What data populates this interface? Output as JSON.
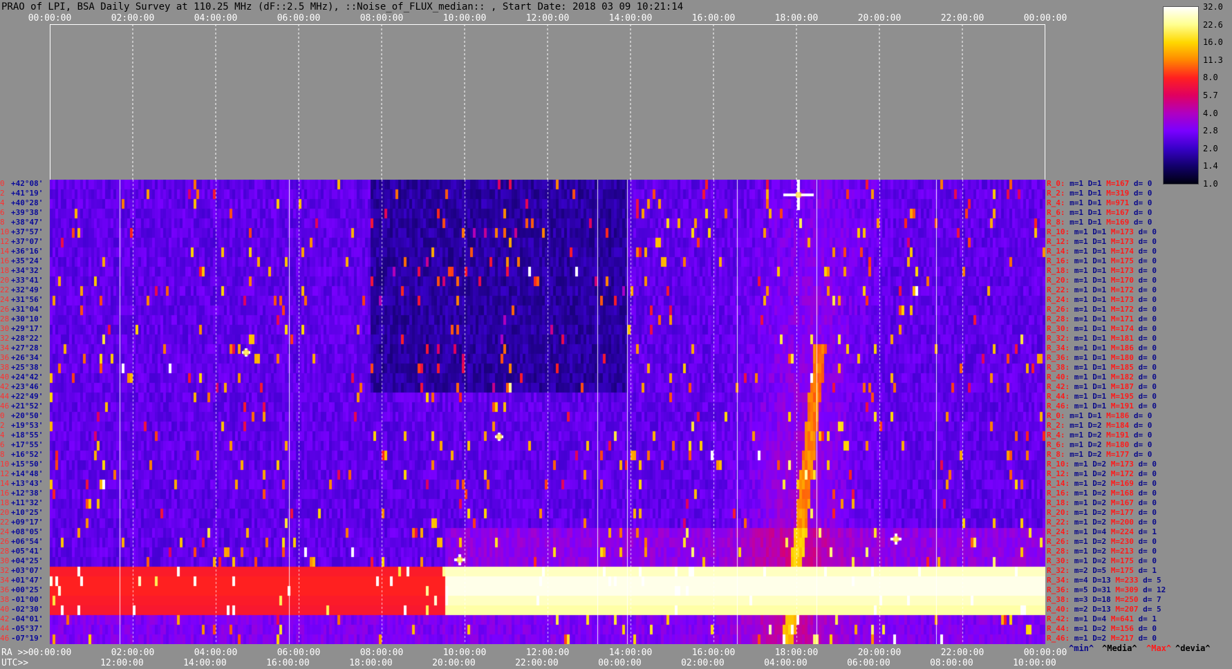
{
  "title": "PRAO of LPI, BSA Daily Survey at 110.25 MHz (dF::2.5 MHz), ::Noise_of_FLUX_median:: , Start Date: 2018 03 09 10:21:14",
  "top_ticks": [
    "00:00:00",
    "02:00:00",
    "04:00:00",
    "06:00:00",
    "08:00:00",
    "10:00:00",
    "12:00:00",
    "14:00:00",
    "16:00:00",
    "18:00:00",
    "20:00:00",
    "22:00:00",
    "00:00:00"
  ],
  "ra_prefix": "RA >>",
  "utc_prefix": "UTC>>",
  "ra_ticks": [
    "00:00:00",
    "02:00:00",
    "04:00:00",
    "06:00:00",
    "08:00:00",
    "10:00:00",
    "12:00:00",
    "14:00:00",
    "16:00:00",
    "18:00:00",
    "20:00:00",
    "22:00:00",
    "00:00:00"
  ],
  "utc_ticks": [
    "12:00:00",
    "14:00:00",
    "16:00:00",
    "18:00:00",
    "20:00:00",
    "22:00:00",
    "00:00:00",
    "02:00:00",
    "04:00:00",
    "06:00:00",
    "08:00:00",
    "10:00:00"
  ],
  "colorbar": {
    "labels": [
      "32.0",
      "22.6",
      "16.0",
      "11.3",
      "8.0",
      "5.7",
      "4.0",
      "2.8",
      "2.0",
      "1.4",
      "1.0"
    ],
    "colors": [
      "#ffffff",
      "#ffff90",
      "#ffd800",
      "#ff8800",
      "#ff2020",
      "#e00060",
      "#b000c0",
      "#7a00ff",
      "#3800c8",
      "#12006a",
      "#000010"
    ]
  },
  "legend_foot": {
    "min": "^min^",
    "median": "^Media^",
    "max": "^Max^",
    "devia": "^devia^"
  },
  "chart_data": {
    "type": "heatmap",
    "title": "PRAO of LPI, BSA Daily Survey at 110.25 MHz (dF::2.5 MHz), ::Noise_of_FLUX_median:: , Start Date: 2018 03 09 10:21:14",
    "xlabel_top": "",
    "xlabel_ra": "RA",
    "xlabel_utc": "UTC",
    "x_range_hours": [
      0,
      24
    ],
    "colorscale_min": 1.0,
    "colorscale_max": 32.0,
    "colorscale": "log",
    "rows": [
      {
        "idx": "0",
        "dec": "+42°08'",
        "r": "R_0:",
        "m": "m=1",
        "d": "D=1",
        "max": "M=167",
        "dv": "d= 0"
      },
      {
        "idx": "2",
        "dec": "+41°19'",
        "r": "R_2:",
        "m": "m=1",
        "d": "D=1",
        "max": "M=319",
        "dv": "d= 0"
      },
      {
        "idx": "4",
        "dec": "+40°28'",
        "r": "R_4:",
        "m": "m=1",
        "d": "D=1",
        "max": "M=971",
        "dv": "d= 0"
      },
      {
        "idx": "6",
        "dec": "+39°38'",
        "r": "R_6:",
        "m": "m=1",
        "d": "D=1",
        "max": "M=167",
        "dv": "d= 0"
      },
      {
        "idx": "8",
        "dec": "+38°47'",
        "r": "R_8:",
        "m": "m=1",
        "d": "D=1",
        "max": "M=169",
        "dv": "d= 0"
      },
      {
        "idx": "10",
        "dec": "+37°57'",
        "r": "R_10:",
        "m": "m=1",
        "d": "D=1",
        "max": "M=173",
        "dv": "d= 0"
      },
      {
        "idx": "12",
        "dec": "+37°07'",
        "r": "R_12:",
        "m": "m=1",
        "d": "D=1",
        "max": "M=173",
        "dv": "d= 0"
      },
      {
        "idx": "14",
        "dec": "+36°16'",
        "r": "R_14:",
        "m": "m=1",
        "d": "D=1",
        "max": "M=174",
        "dv": "d= 0"
      },
      {
        "idx": "16",
        "dec": "+35°24'",
        "r": "R_16:",
        "m": "m=1",
        "d": "D=1",
        "max": "M=175",
        "dv": "d= 0"
      },
      {
        "idx": "18",
        "dec": "+34°32'",
        "r": "R_18:",
        "m": "m=1",
        "d": "D=1",
        "max": "M=173",
        "dv": "d= 0"
      },
      {
        "idx": "20",
        "dec": "+33°41'",
        "r": "R_20:",
        "m": "m=1",
        "d": "D=1",
        "max": "M=170",
        "dv": "d= 0"
      },
      {
        "idx": "22",
        "dec": "+32°49'",
        "r": "R_22:",
        "m": "m=1",
        "d": "D=1",
        "max": "M=172",
        "dv": "d= 0"
      },
      {
        "idx": "24",
        "dec": "+31°56'",
        "r": "R_24:",
        "m": "m=1",
        "d": "D=1",
        "max": "M=173",
        "dv": "d= 0"
      },
      {
        "idx": "26",
        "dec": "+31°04'",
        "r": "R_26:",
        "m": "m=1",
        "d": "D=1",
        "max": "M=172",
        "dv": "d= 0"
      },
      {
        "idx": "28",
        "dec": "+30°10'",
        "r": "R_28:",
        "m": "m=1",
        "d": "D=1",
        "max": "M=171",
        "dv": "d= 0"
      },
      {
        "idx": "30",
        "dec": "+29°17'",
        "r": "R_30:",
        "m": "m=1",
        "d": "D=1",
        "max": "M=174",
        "dv": "d= 0"
      },
      {
        "idx": "32",
        "dec": "+28°22'",
        "r": "R_32:",
        "m": "m=1",
        "d": "D=1",
        "max": "M=181",
        "dv": "d= 0"
      },
      {
        "idx": "34",
        "dec": "+27°28'",
        "r": "R_34:",
        "m": "m=1",
        "d": "D=1",
        "max": "M=186",
        "dv": "d= 0"
      },
      {
        "idx": "36",
        "dec": "+26°34'",
        "r": "R_36:",
        "m": "m=1",
        "d": "D=1",
        "max": "M=180",
        "dv": "d= 0"
      },
      {
        "idx": "38",
        "dec": "+25°38'",
        "r": "R_38:",
        "m": "m=1",
        "d": "D=1",
        "max": "M=185",
        "dv": "d= 0"
      },
      {
        "idx": "40",
        "dec": "+24°42'",
        "r": "R_40:",
        "m": "m=1",
        "d": "D=1",
        "max": "M=182",
        "dv": "d= 0"
      },
      {
        "idx": "42",
        "dec": "+23°46'",
        "r": "R_42:",
        "m": "m=1",
        "d": "D=1",
        "max": "M=187",
        "dv": "d= 0"
      },
      {
        "idx": "44",
        "dec": "+22°49'",
        "r": "R_44:",
        "m": "m=1",
        "d": "D=1",
        "max": "M=195",
        "dv": "d= 0"
      },
      {
        "idx": "46",
        "dec": "+21°52'",
        "r": "R_46:",
        "m": "m=1",
        "d": "D=1",
        "max": "M=191",
        "dv": "d= 0"
      },
      {
        "idx": "0",
        "dec": "+20°50'",
        "r": "R_0:",
        "m": "m=1",
        "d": "D=1",
        "max": "M=186",
        "dv": "d= 0"
      },
      {
        "idx": "2",
        "dec": "+19°53'",
        "r": "R_2:",
        "m": "m=1",
        "d": "D=2",
        "max": "M=184",
        "dv": "d= 0"
      },
      {
        "idx": "4",
        "dec": "+18°55'",
        "r": "R_4:",
        "m": "m=1",
        "d": "D=2",
        "max": "M=191",
        "dv": "d= 0"
      },
      {
        "idx": "6",
        "dec": "+17°55'",
        "r": "R_6:",
        "m": "m=1",
        "d": "D=2",
        "max": "M=180",
        "dv": "d= 0"
      },
      {
        "idx": "8",
        "dec": "+16°52'",
        "r": "R_8:",
        "m": "m=1",
        "d": "D=2",
        "max": "M=177",
        "dv": "d= 0"
      },
      {
        "idx": "10",
        "dec": "+15°50'",
        "r": "R_10:",
        "m": "m=1",
        "d": "D=2",
        "max": "M=173",
        "dv": "d= 0"
      },
      {
        "idx": "12",
        "dec": "+14°48'",
        "r": "R_12:",
        "m": "m=1",
        "d": "D=2",
        "max": "M=172",
        "dv": "d= 0"
      },
      {
        "idx": "14",
        "dec": "+13°43'",
        "r": "R_14:",
        "m": "m=1",
        "d": "D=2",
        "max": "M=169",
        "dv": "d= 0"
      },
      {
        "idx": "16",
        "dec": "+12°38'",
        "r": "R_16:",
        "m": "m=1",
        "d": "D=2",
        "max": "M=168",
        "dv": "d= 0"
      },
      {
        "idx": "18",
        "dec": "+11°32'",
        "r": "R_18:",
        "m": "m=1",
        "d": "D=2",
        "max": "M=167",
        "dv": "d= 0"
      },
      {
        "idx": "20",
        "dec": "+10°25'",
        "r": "R_20:",
        "m": "m=1",
        "d": "D=2",
        "max": "M=177",
        "dv": "d= 0"
      },
      {
        "idx": "22",
        "dec": "+09°17'",
        "r": "R_22:",
        "m": "m=1",
        "d": "D=2",
        "max": "M=200",
        "dv": "d= 0"
      },
      {
        "idx": "24",
        "dec": "+08°05'",
        "r": "R_24:",
        "m": "m=1",
        "d": "D=4",
        "max": "M=224",
        "dv": "d= 1"
      },
      {
        "idx": "26",
        "dec": "+06°54'",
        "r": "R_26:",
        "m": "m=1",
        "d": "D=2",
        "max": "M=230",
        "dv": "d= 0"
      },
      {
        "idx": "28",
        "dec": "+05°41'",
        "r": "R_28:",
        "m": "m=1",
        "d": "D=2",
        "max": "M=213",
        "dv": "d= 0"
      },
      {
        "idx": "30",
        "dec": "+04°25'",
        "r": "R_30:",
        "m": "m=1",
        "d": "D=2",
        "max": "M=175",
        "dv": "d= 0"
      },
      {
        "idx": "32",
        "dec": "+03°07'",
        "r": "R_32:",
        "m": "m=2",
        "d": "D=5",
        "max": "M=175",
        "dv": "d= 1"
      },
      {
        "idx": "34",
        "dec": "+01°47'",
        "r": "R_34:",
        "m": "m=4",
        "d": "D=13",
        "max": "M=233",
        "dv": "d= 5"
      },
      {
        "idx": "36",
        "dec": "+00°25'",
        "r": "R_36:",
        "m": "m=5",
        "d": "D=31",
        "max": "M=309",
        "dv": "d= 12"
      },
      {
        "idx": "38",
        "dec": "-01°00'",
        "r": "R_38:",
        "m": "m=3",
        "d": "D=18",
        "max": "M=250",
        "dv": "d= 7"
      },
      {
        "idx": "40",
        "dec": "-02°30'",
        "r": "R_40:",
        "m": "m=2",
        "d": "D=13",
        "max": "M=207",
        "dv": "d= 5"
      },
      {
        "idx": "42",
        "dec": "-04°01'",
        "r": "R_42:",
        "m": "m=1",
        "d": "D=4",
        "max": "M=641",
        "dv": "d= 1"
      },
      {
        "idx": "44",
        "dec": "-05°37'",
        "r": "R_44:",
        "m": "m=1",
        "d": "D=2",
        "max": "M=156",
        "dv": "d= 0"
      },
      {
        "idx": "46",
        "dec": "-07°19'",
        "r": "R_46:",
        "m": "m=1",
        "d": "D=2",
        "max": "M=217",
        "dv": "d= 0"
      }
    ]
  }
}
